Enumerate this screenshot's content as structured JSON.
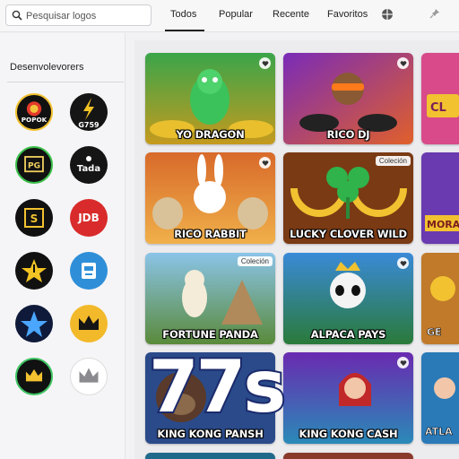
{
  "search": {
    "placeholder": "Pesquisar logos"
  },
  "tabs": [
    "Todos",
    "Popular",
    "Recente",
    "Favoritos"
  ],
  "active_tab": "Todos",
  "sidebar": {
    "title": "Desenvolevorers",
    "providers": [
      {
        "label": "POPOK",
        "icon": "lion-logo-icon"
      },
      {
        "label": "G759",
        "icon": "lightning-logo-icon"
      },
      {
        "label": "PG",
        "icon": "pg-logo-icon"
      },
      {
        "label": "Tada",
        "icon": "tada-logo-icon"
      },
      {
        "label": "S",
        "icon": "s-logo-icon"
      },
      {
        "label": "JDB",
        "icon": "jdb-logo-icon"
      },
      {
        "label": "",
        "icon": "power-star-logo-icon"
      },
      {
        "label": "",
        "icon": "robot-logo-icon"
      },
      {
        "label": "",
        "icon": "blue-star-logo-icon"
      },
      {
        "label": "",
        "icon": "gold-crown-logo-icon"
      },
      {
        "label": "",
        "icon": "crown-green-logo-icon"
      },
      {
        "label": "",
        "icon": "silver-crown-logo-icon"
      }
    ]
  },
  "games": [
    {
      "title": "YO DRAGON",
      "badge": "",
      "favorite_icon": "heart-icon"
    },
    {
      "title": "RICO DJ",
      "badge": "",
      "favorite_icon": "heart-icon"
    },
    {
      "title": "CL",
      "badge": "",
      "favorite_icon": ""
    },
    {
      "title": "RICO RABBIT",
      "badge": "",
      "favorite_icon": "heart-icon"
    },
    {
      "title": "LUCKY CLOVER WILD",
      "badge": "Coleción",
      "favorite_icon": ""
    },
    {
      "title": "MORA",
      "badge": "",
      "favorite_icon": ""
    },
    {
      "title": "FORTUNE PANDA",
      "badge": "Coleción",
      "favorite_icon": ""
    },
    {
      "title": "ALPACA PAYS",
      "badge": "",
      "favorite_icon": "heart-icon"
    },
    {
      "title": "GE",
      "badge": "",
      "favorite_icon": ""
    },
    {
      "title": "KING KONG PANSH",
      "badge": "",
      "favorite_icon": ""
    },
    {
      "title": "KING KONG CASH",
      "badge": "",
      "favorite_icon": "heart-icon"
    },
    {
      "title": "ATLA",
      "badge": "",
      "favorite_icon": ""
    }
  ],
  "overlay_text": "77s",
  "colors": {
    "accent": "#1b2a6b",
    "background": "#f2f2f4"
  }
}
